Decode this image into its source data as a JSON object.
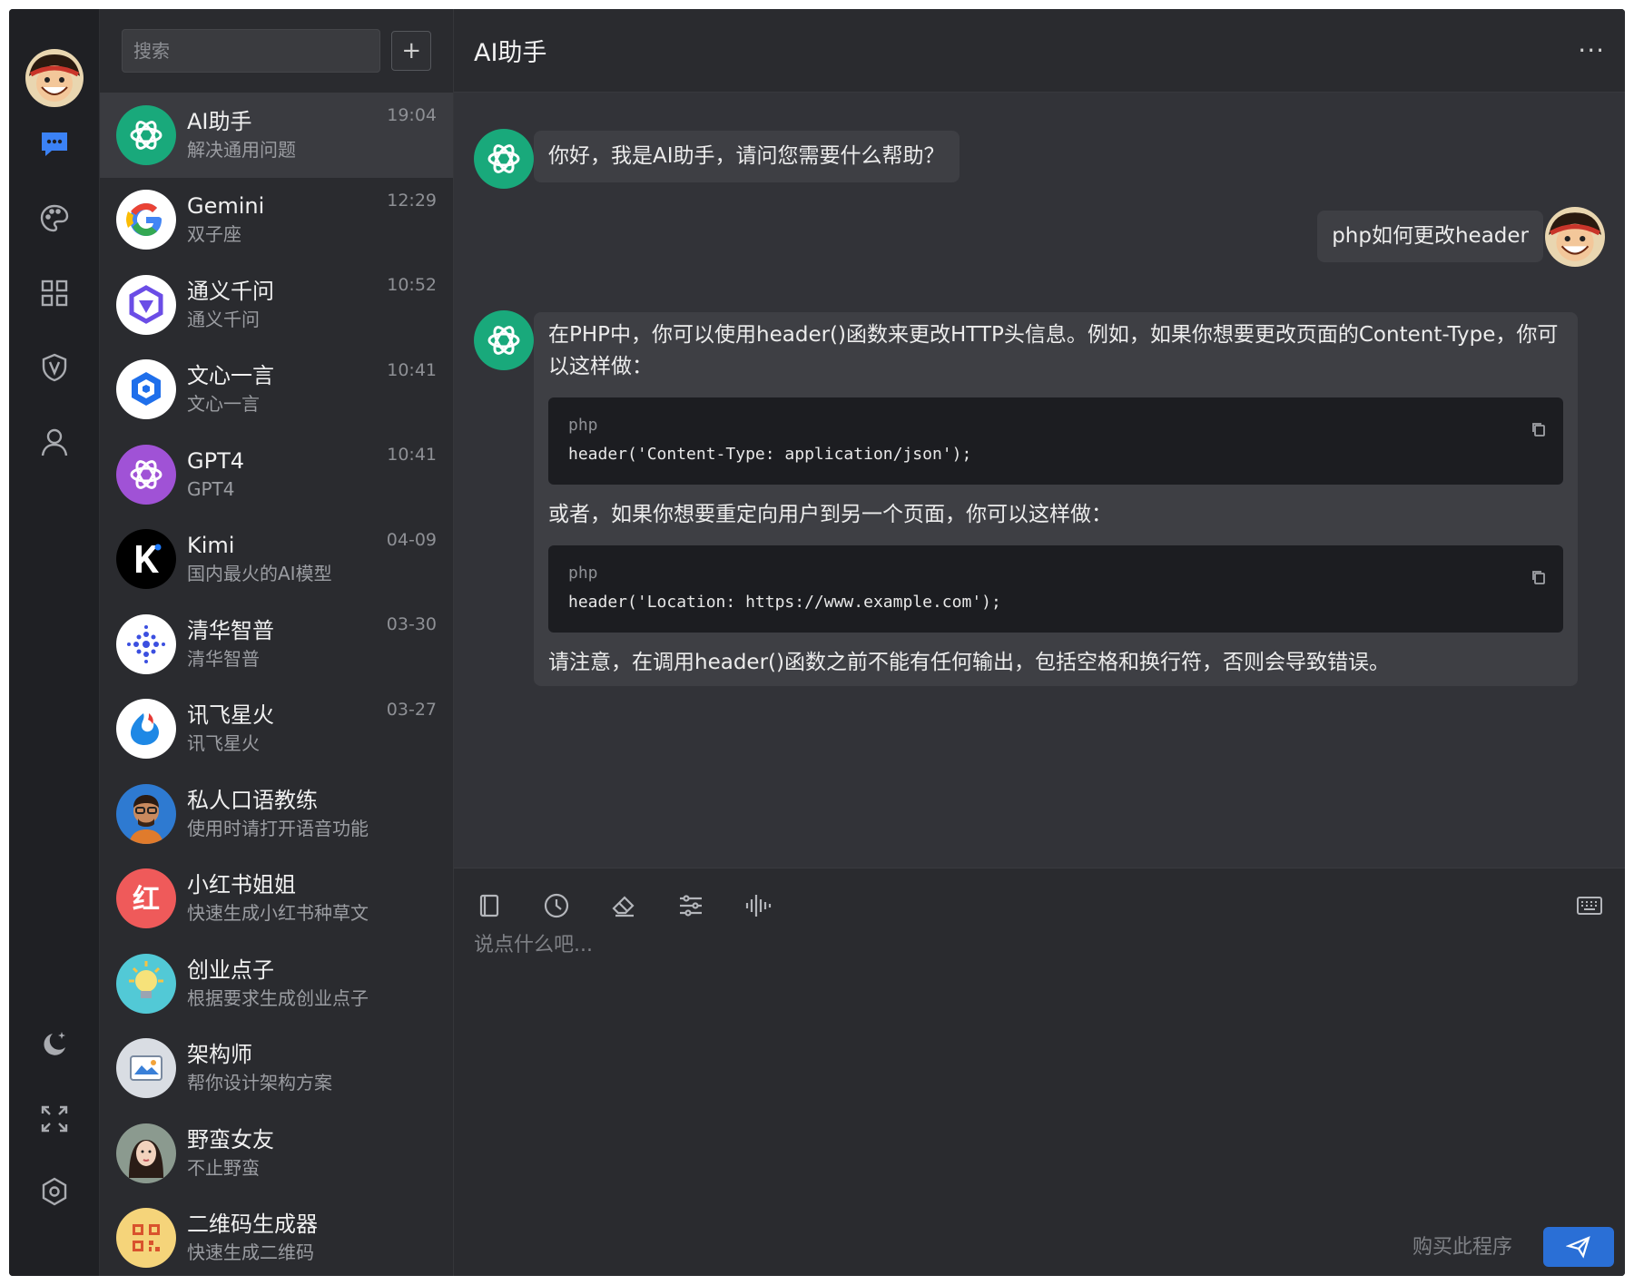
{
  "search": {
    "placeholder": "搜索",
    "add_label": "+"
  },
  "contacts": [
    {
      "name": "AI助手",
      "desc": "解决通用问题",
      "time": "19:04",
      "icon": "openai-icon",
      "color": "#19a97b"
    },
    {
      "name": "Gemini",
      "desc": "双子座",
      "time": "12:29",
      "icon": "google-icon",
      "color": "#ffffff"
    },
    {
      "name": "通义千问",
      "desc": "通义千问",
      "time": "10:52",
      "icon": "tongyi-icon",
      "color": "#ffffff"
    },
    {
      "name": "文心一言",
      "desc": "文心一言",
      "time": "10:41",
      "icon": "wenxin-icon",
      "color": "#ffffff"
    },
    {
      "name": "GPT4",
      "desc": "GPT4",
      "time": "10:41",
      "icon": "openai-icon",
      "color": "#a052d6"
    },
    {
      "name": "Kimi",
      "desc": "国内最火的AI模型",
      "time": "04-09",
      "icon": "kimi-icon",
      "color": "#000000"
    },
    {
      "name": "清华智普",
      "desc": "清华智普",
      "time": "03-30",
      "icon": "zhipu-icon",
      "color": "#ffffff"
    },
    {
      "name": "讯飞星火",
      "desc": "讯飞星火",
      "time": "03-27",
      "icon": "xunfei-icon",
      "color": "#ffffff"
    },
    {
      "name": "私人口语教练",
      "desc": "使用时请打开语音功能",
      "time": "",
      "icon": "tutor-avatar-icon",
      "color": "#2e7ad1"
    },
    {
      "name": "小红书姐姐",
      "desc": "快速生成小红书种草文",
      "time": "",
      "icon": "xiaohongshu-icon",
      "color": "#ef5a5a"
    },
    {
      "name": "创业点子",
      "desc": "根据要求生成创业点子",
      "time": "",
      "icon": "lightbulb-icon",
      "color": "#52c9d6"
    },
    {
      "name": "架构师",
      "desc": "帮你设计架构方案",
      "time": "",
      "icon": "architect-icon",
      "color": "#d9dde3"
    },
    {
      "name": "野蛮女友",
      "desc": "不止野蛮",
      "time": "",
      "icon": "girlfriend-avatar-icon",
      "color": "#8b9a8f"
    },
    {
      "name": "二维码生成器",
      "desc": "快速生成二维码",
      "time": "",
      "icon": "qrcode-icon",
      "color": "#f5d47a"
    }
  ],
  "chat": {
    "title": "AI助手",
    "more": "···",
    "messages": {
      "greeting": "你好，我是AI助手，请问您需要什么帮助？",
      "user": "php如何更改header",
      "answer_intro": "在PHP中，你可以使用header()函数来更改HTTP头信息。例如，如果你想要更改页面的Content-Type，你可以这样做：",
      "code1_lang": "php",
      "code1": "header('Content-Type: application/json');",
      "answer_mid": "或者，如果你想要重定向用户到另一个页面，你可以这样做：",
      "code2_lang": "php",
      "code2": "header('Location: https://www.example.com');",
      "answer_end": "请注意，在调用header()函数之前不能有任何输出，包括空格和换行符，否则会导致错误。"
    }
  },
  "input": {
    "placeholder": "说点什么吧...",
    "buy_label": "购买此程序"
  },
  "colors": {
    "accent": "#2a6fd6",
    "chat_icon_active": "#3b82f6",
    "openai_green": "#19a97b"
  }
}
